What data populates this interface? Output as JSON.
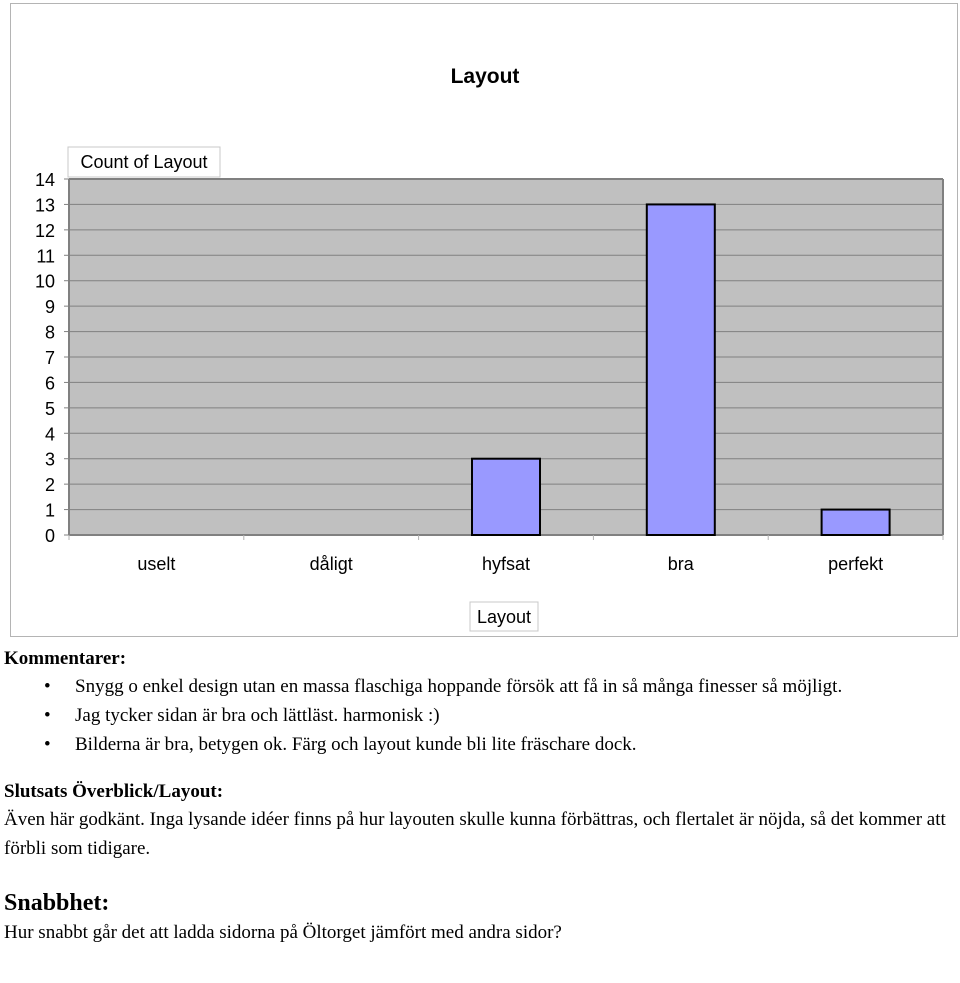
{
  "chart_data": {
    "type": "bar",
    "title": "Layout",
    "series_label": "Count of Layout",
    "xlabel": "Layout",
    "ylabel": "",
    "categories": [
      "uselt",
      "dåligt",
      "hyfsat",
      "bra",
      "perfekt"
    ],
    "values": [
      0,
      0,
      3,
      13,
      1
    ],
    "ylim": [
      0,
      14
    ],
    "yticks": [
      "0",
      "1",
      "2",
      "3",
      "4",
      "5",
      "6",
      "7",
      "8",
      "9",
      "10",
      "11",
      "12",
      "13",
      "14"
    ],
    "grid": true,
    "legend": "none",
    "colors": {
      "bar": "#9999ff",
      "plot_bg": "#c0c0c0",
      "gridline": "#808080"
    }
  },
  "comments": {
    "heading": "Kommentarer:",
    "items": [
      "Snygg o enkel design utan en massa flaschiga hoppande försök att få in så många finesser så möjligt.",
      "Jag tycker sidan är bra och lättläst. harmonisk :)",
      "Bilderna är bra, betygen ok. Färg och layout kunde bli lite fräschare dock."
    ],
    "bullet": "•"
  },
  "conclusion": {
    "heading": "Slutsats Överblick/Layout:",
    "text": "Även här godkänt. Inga lysande idéer finns på hur layouten skulle kunna förbättras, och flertalet är nöjda, så det kommer att förbli som tidigare."
  },
  "speed": {
    "heading": "Snabbhet:",
    "text": "Hur snabbt går det att ladda sidorna på Öltorget jämfört med andra sidor?"
  }
}
